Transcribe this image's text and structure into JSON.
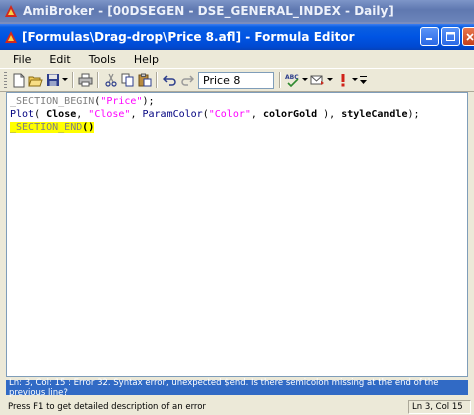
{
  "app": {
    "title": "AmiBroker - [00DSEGEN - DSE_GENERAL_INDEX - Daily]"
  },
  "editor": {
    "title": "[Formulas\\Drag-drop\\Price 8.afl] - Formula Editor"
  },
  "menu": {
    "items": [
      "File",
      "Edit",
      "Tools",
      "Help"
    ]
  },
  "toolbar": {
    "chart_select_value": "Price 8"
  },
  "code": {
    "line1_section_begin": "_SECTION_BEGIN",
    "line1_paren_open": "(",
    "line1_arg": "\"Price\"",
    "line1_end": ");",
    "line2_plot": "Plot",
    "line2_p1": "( ",
    "line2_close": "Close",
    "line2_c1": ", ",
    "line2_close_str": "\"Close\"",
    "line2_c2": ", ",
    "line2_paramcolor": "ParamColor",
    "line2_p2": "(",
    "line2_color_str": "\"Color\"",
    "line2_c3": ", ",
    "line2_colorgold": "colorGold",
    "line2_p3": " ), ",
    "line2_stylecandle": "styleCandle",
    "line2_end": ");",
    "line3_section_end": "_SECTION_END",
    "line3_paren": "()"
  },
  "error": {
    "message": "Ln: 3, Col: 15 : Error 32. Syntax error, unexpected $end. Is there semicolon missing at the end of the previous line?"
  },
  "status": {
    "hint": "Press F1 to get detailed description of an error",
    "position": "Ln 3, Col 15"
  },
  "colors": {
    "title_bar": "#0054e3",
    "error_bar": "#316ac5",
    "highlight": "#ffff00",
    "string": "#ff00ff"
  }
}
